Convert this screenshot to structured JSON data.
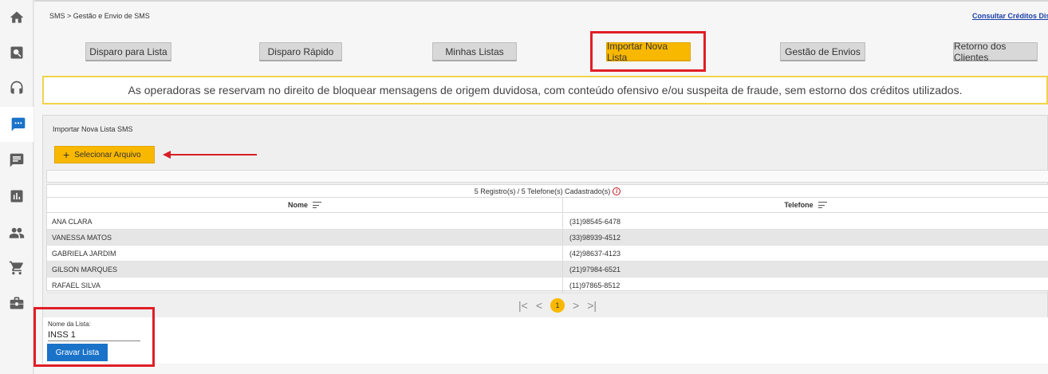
{
  "breadcrumb": "SMS > Gestão e Envio de SMS",
  "credits_link": "Consultar Créditos Disp",
  "tabs": [
    {
      "label": "Disparo para Lista"
    },
    {
      "label": "Disparo Rápido"
    },
    {
      "label": "Minhas Listas"
    },
    {
      "label": "Importar Nova Lista",
      "active": true
    },
    {
      "label": "Gestão de Envios"
    },
    {
      "label": "Retorno dos Clientes"
    }
  ],
  "warning": "As operadoras se reservam no direito de bloquear mensagens de origem duvidosa, com conteúdo ofensivo e/ou suspeita de fraude, sem estorno dos créditos utilizados.",
  "import": {
    "title": "Importar Nova Lista SMS",
    "select_file_label": "Selecionar Arquivo",
    "select_file_icon": "plus-icon"
  },
  "grid": {
    "summary": "5 Registro(s) / 5 Telefone(s) Cadastrado(s)",
    "columns": [
      "Nome",
      "Telefone"
    ],
    "rows": [
      {
        "nome": "ANA CLARA",
        "telefone": "(31)98545-6478"
      },
      {
        "nome": "VANESSA MATOS",
        "telefone": "(33)98939-4512"
      },
      {
        "nome": "GABRIELA JARDIM",
        "telefone": "(42)98637-4123"
      },
      {
        "nome": "GILSON MARQUES",
        "telefone": "(21)97984-6521"
      },
      {
        "nome": "RAFAEL SILVA",
        "telefone": "(11)97865-8512"
      }
    ]
  },
  "pagination": {
    "current_page": "1",
    "first_icon": "|<",
    "prev_icon": "<",
    "next_icon": ">",
    "last_icon": ">|"
  },
  "form": {
    "label": "Nome da Lista:",
    "value": "INSS 1",
    "save_label": "Gravar Lista"
  },
  "sidebar": {
    "items": [
      "home-icon",
      "search-icon",
      "headset-icon",
      "sms-icon",
      "message-icon",
      "chart-icon",
      "people-icon",
      "cart-icon",
      "briefcase-icon"
    ]
  },
  "colors": {
    "accent": "#f9b800",
    "primary": "#1a73c9",
    "highlight": "#e01e26",
    "warning_border": "#f2d34a"
  }
}
